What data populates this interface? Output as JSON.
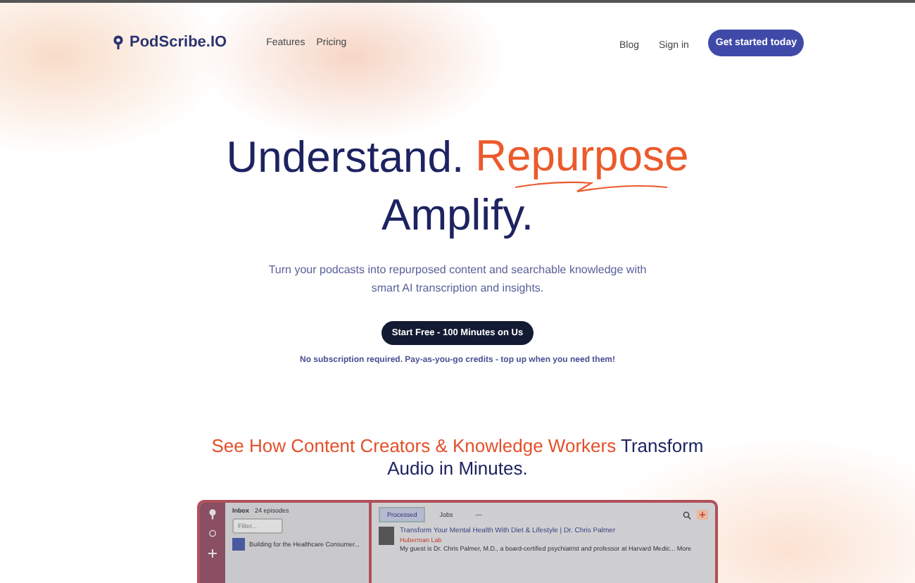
{
  "header": {
    "brand": "PodScribe.IO",
    "nav_left": [
      "Features",
      "Pricing"
    ],
    "nav_right": [
      "Blog",
      "Sign in"
    ],
    "cta": "Get started today"
  },
  "hero": {
    "headline_lines": [
      [
        {
          "text": "Understand.",
          "kind": "plain"
        },
        {
          "text": "Repurpose",
          "kind": "accent"
        }
      ],
      [
        {
          "text": "Amplify.",
          "kind": "plain"
        }
      ]
    ],
    "subtitle": "Turn your podcasts into repurposed content and searchable knowledge with smart AI transcription and insights.",
    "button": "Start Free - 100 Minutes on Us",
    "note": "No subscription required. Pay-as-you-go credits - top up when you need them!"
  },
  "showcase": {
    "title": [
      {
        "text": "See How Content Creators & Knowledge Workers",
        "kind": "accent"
      },
      {
        "text": "Transform Audio in Minutes.",
        "kind": "plain"
      }
    ],
    "app": {
      "inbox_title": "Inbox",
      "inbox_count": "24 episodes",
      "filter_placeholder": "Filter...",
      "episodes": [
        {
          "title": "Building for the Healthcare Consumer..."
        }
      ],
      "tabs": [
        {
          "label": "Processed",
          "selected": true
        },
        {
          "label": "Jobs",
          "selected": false
        },
        {
          "label": "—",
          "selected": false
        }
      ],
      "episode": {
        "title": "Transform Your Mental Health With Diet & Lifestyle | Dr. Chris Palmer",
        "show": "Huberman Lab",
        "description": "My guest is Dr. Chris Palmer, M.D., a board-certified psychiatrist and professor at Harvard Medic...",
        "more": "More"
      }
    }
  }
}
